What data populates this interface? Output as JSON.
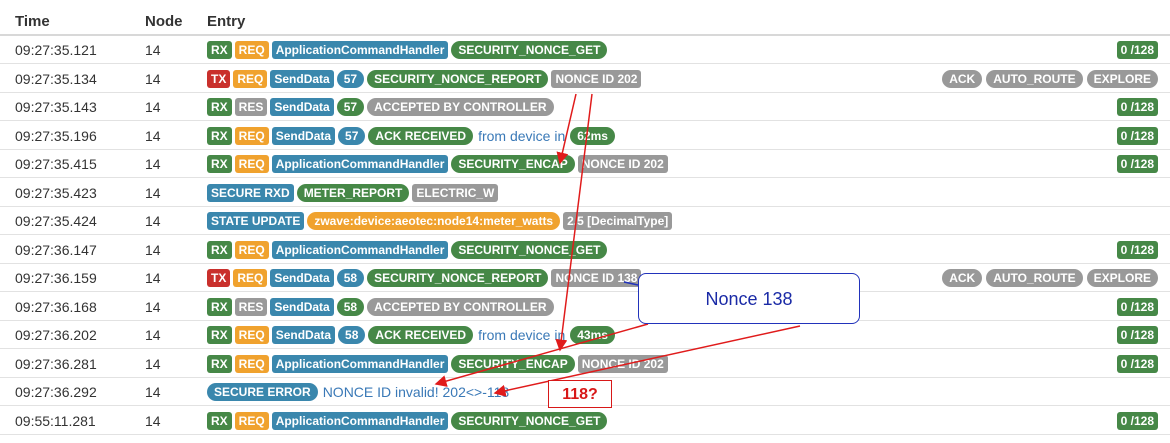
{
  "columns": {
    "time": "Time",
    "node": "Node",
    "entry": "Entry"
  },
  "rows": [
    {
      "time": "09:27:35.121",
      "node": "14",
      "badges": [
        [
          "RX",
          "grn"
        ],
        [
          "REQ",
          "org"
        ],
        [
          "ApplicationCommandHandler",
          "blu"
        ],
        [
          "SECURITY_NONCE_GET",
          "grn",
          "p"
        ]
      ],
      "right": [
        [
          "0 /128",
          "grn"
        ]
      ]
    },
    {
      "time": "09:27:35.134",
      "node": "14",
      "badges": [
        [
          "TX",
          "red"
        ],
        [
          "REQ",
          "org"
        ],
        [
          "SendData",
          "blu"
        ],
        [
          "57",
          "blu",
          "p"
        ],
        [
          "SECURITY_NONCE_REPORT",
          "grn",
          "p"
        ],
        [
          "NONCE ID 202",
          "gry"
        ]
      ],
      "right": [
        [
          "ACK",
          "gry",
          "p"
        ],
        [
          "AUTO_ROUTE",
          "gry",
          "p"
        ],
        [
          "EXPLORE",
          "gry",
          "p"
        ]
      ]
    },
    {
      "time": "09:27:35.143",
      "node": "14",
      "badges": [
        [
          "RX",
          "grn"
        ],
        [
          "RES",
          "gry"
        ],
        [
          "SendData",
          "blu"
        ],
        [
          "57",
          "grn",
          "p"
        ],
        [
          "ACCEPTED BY CONTROLLER",
          "gry",
          "p"
        ]
      ],
      "right": [
        [
          "0 /128",
          "grn"
        ]
      ]
    },
    {
      "time": "09:27:35.196",
      "node": "14",
      "badges": [
        [
          "RX",
          "grn"
        ],
        [
          "REQ",
          "org"
        ],
        [
          "SendData",
          "blu"
        ],
        [
          "57",
          "blu",
          "p"
        ],
        [
          "ACK RECEIVED",
          "grn",
          "p"
        ],
        [
          "from device in",
          "txt"
        ],
        [
          "62ms",
          "grn",
          "p"
        ]
      ],
      "right": [
        [
          "0 /128",
          "grn"
        ]
      ]
    },
    {
      "time": "09:27:35.415",
      "node": "14",
      "badges": [
        [
          "RX",
          "grn"
        ],
        [
          "REQ",
          "org"
        ],
        [
          "ApplicationCommandHandler",
          "blu"
        ],
        [
          "SECURITY_ENCAP",
          "grn",
          "p"
        ],
        [
          "NONCE ID 202",
          "gry"
        ]
      ],
      "right": [
        [
          "0 /128",
          "grn"
        ]
      ]
    },
    {
      "time": "09:27:35.423",
      "node": "14",
      "badges": [
        [
          "SECURE RXD",
          "blu"
        ],
        [
          "METER_REPORT",
          "grn",
          "p"
        ],
        [
          "ELECTRIC_W",
          "gry"
        ]
      ],
      "right": []
    },
    {
      "time": "09:27:35.424",
      "node": "14",
      "badges": [
        [
          "STATE UPDATE",
          "blu"
        ],
        [
          "zwave:device:aeotec:node14:meter_watts",
          "org",
          "p"
        ],
        [
          "2.5 [DecimalType]",
          "gry"
        ]
      ],
      "right": []
    },
    {
      "time": "09:27:36.147",
      "node": "14",
      "badges": [
        [
          "RX",
          "grn"
        ],
        [
          "REQ",
          "org"
        ],
        [
          "ApplicationCommandHandler",
          "blu"
        ],
        [
          "SECURITY_NONCE_GET",
          "grn",
          "p"
        ]
      ],
      "right": [
        [
          "0 /128",
          "grn"
        ]
      ]
    },
    {
      "time": "09:27:36.159",
      "node": "14",
      "badges": [
        [
          "TX",
          "red"
        ],
        [
          "REQ",
          "org"
        ],
        [
          "SendData",
          "blu"
        ],
        [
          "58",
          "blu",
          "p"
        ],
        [
          "SECURITY_NONCE_REPORT",
          "grn",
          "p"
        ],
        [
          "NONCE ID 138",
          "gry"
        ]
      ],
      "right": [
        [
          "ACK",
          "gry",
          "p"
        ],
        [
          "AUTO_ROUTE",
          "gry",
          "p"
        ],
        [
          "EXPLORE",
          "gry",
          "p"
        ]
      ]
    },
    {
      "time": "09:27:36.168",
      "node": "14",
      "badges": [
        [
          "RX",
          "grn"
        ],
        [
          "RES",
          "gry"
        ],
        [
          "SendData",
          "blu"
        ],
        [
          "58",
          "grn",
          "p"
        ],
        [
          "ACCEPTED BY CONTROLLER",
          "gry",
          "p"
        ]
      ],
      "right": [
        [
          "0 /128",
          "grn"
        ]
      ]
    },
    {
      "time": "09:27:36.202",
      "node": "14",
      "badges": [
        [
          "RX",
          "grn"
        ],
        [
          "REQ",
          "org"
        ],
        [
          "SendData",
          "blu"
        ],
        [
          "58",
          "blu",
          "p"
        ],
        [
          "ACK RECEIVED",
          "grn",
          "p"
        ],
        [
          "from device in",
          "txt"
        ],
        [
          "43ms",
          "grn",
          "p"
        ]
      ],
      "right": [
        [
          "0 /128",
          "grn"
        ]
      ]
    },
    {
      "time": "09:27:36.281",
      "node": "14",
      "badges": [
        [
          "RX",
          "grn"
        ],
        [
          "REQ",
          "org"
        ],
        [
          "ApplicationCommandHandler",
          "blu"
        ],
        [
          "SECURITY_ENCAP",
          "grn",
          "p"
        ],
        [
          "NONCE ID 202",
          "gry"
        ]
      ],
      "right": [
        [
          "0 /128",
          "grn"
        ]
      ]
    },
    {
      "time": "09:27:36.292",
      "node": "14",
      "badges": [
        [
          "SECURE ERROR",
          "blu",
          "p"
        ],
        [
          "NONCE ID invalid! 202<>-118",
          "txt"
        ]
      ],
      "right": []
    },
    {
      "time": "09:55:11.281",
      "node": "14",
      "badges": [
        [
          "RX",
          "grn"
        ],
        [
          "REQ",
          "org"
        ],
        [
          "ApplicationCommandHandler",
          "blu"
        ],
        [
          "SECURITY_NONCE_GET",
          "grn",
          "p"
        ]
      ],
      "right": [
        [
          "0 /128",
          "grn"
        ]
      ]
    }
  ],
  "annotations": {
    "callout": "Nonce 138",
    "note": "118?",
    "arrow_color": "#e01b1b"
  }
}
